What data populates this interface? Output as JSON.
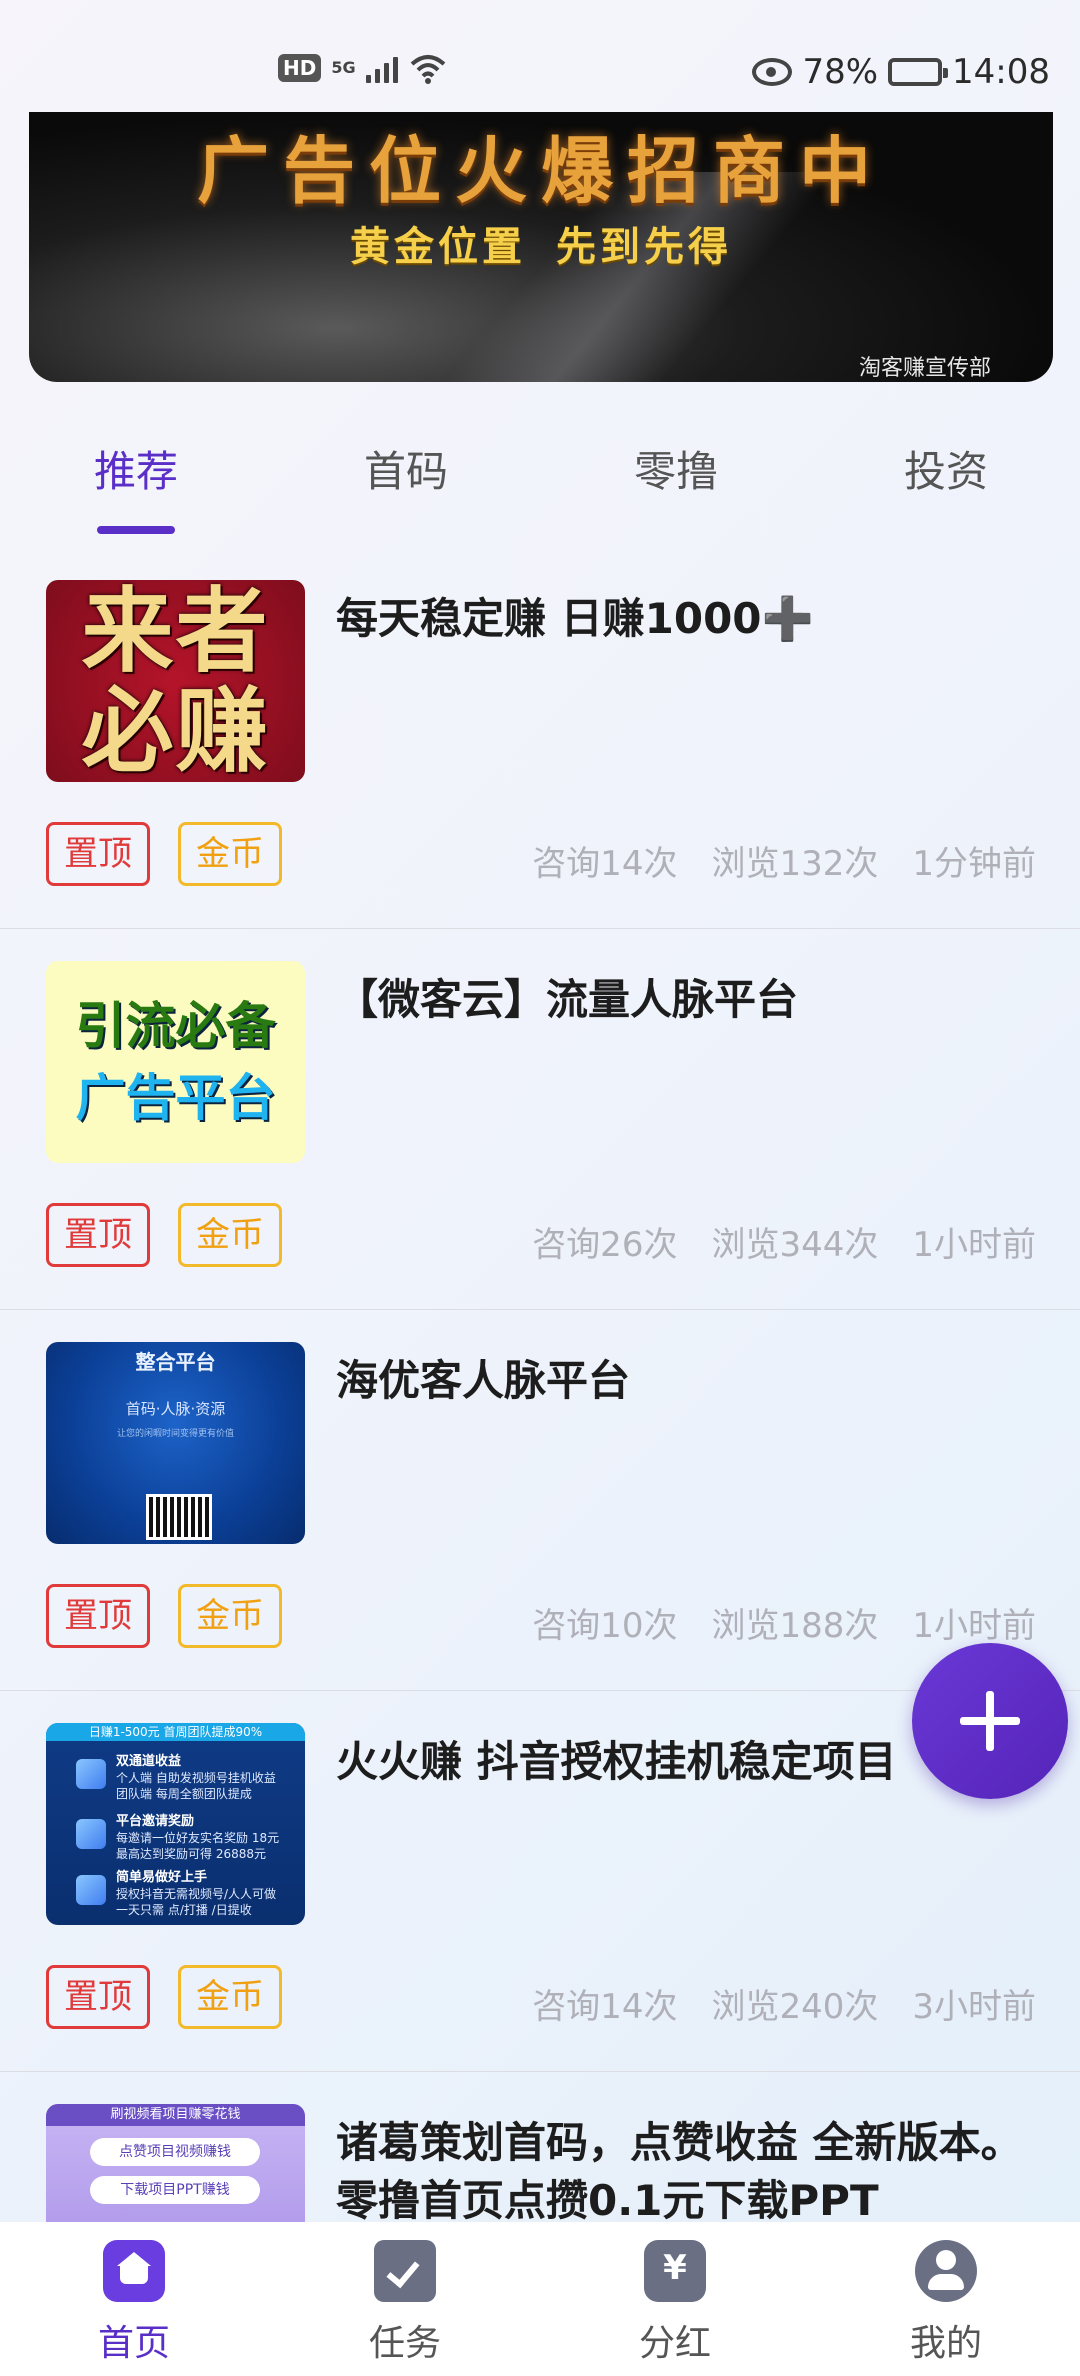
{
  "status_bar": {
    "hd": "HD",
    "network": "5G",
    "battery_percent": "78%",
    "battery_level": 0.78,
    "time": "14:08"
  },
  "banner": {
    "title": "广告位火爆招商中",
    "subtitle_left": "黄金位置",
    "subtitle_right": "先到先得",
    "credit": "淘客赚宣传部"
  },
  "tabs": [
    "推荐",
    "首码",
    "零撸",
    "投资"
  ],
  "active_tab": 0,
  "tags": {
    "top": "置顶",
    "coin": "金币"
  },
  "feed": [
    {
      "title": "每天稳定赚 日赚1000➕",
      "consult": "咨询14次",
      "views": "浏览132次",
      "time": "1分钟前",
      "thumb": {
        "line1": "来者",
        "line2": "必赚"
      }
    },
    {
      "title": "【微客云】流量人脉平台",
      "consult": "咨询26次",
      "views": "浏览344次",
      "time": "1小时前",
      "thumb": {
        "line1": "引流必备",
        "line2": "广告平台"
      }
    },
    {
      "title": "海优客人脉平台",
      "consult": "咨询10次",
      "views": "浏览188次",
      "time": "1小时前",
      "thumb": {
        "line1": "整合平台",
        "line2": "首码·人脉·资源",
        "line3": "让您的闲暇时间变得更有价值"
      }
    },
    {
      "title": "火火赚 抖音授权挂机稳定项目",
      "consult": "咨询14次",
      "views": "浏览240次",
      "time": "3小时前",
      "thumb": {
        "header": "日赚1-500元 首周团队提成90%",
        "r1a": "双通道收益",
        "r1b": "个人端 自助发视频号挂机收益",
        "r1c": "团队端 每周全额团队提成",
        "r2a": "平台邀请奖励",
        "r2b": "每邀请一位好友实名奖励 18元",
        "r2c": "最高达到奖励可得 26888元",
        "r3a": "简单易做好上手",
        "r3b": "授权抖音无需视频号/人人可做",
        "r3c": "一天只需 点/打播 /日提收"
      }
    },
    {
      "title": "诸葛策划首码，点赞收益 全新版本。 零撸首页点攒0.1元下载PPT",
      "consult": "",
      "views": "",
      "time": "",
      "thumb": {
        "header": "刷视频看项目赚零花钱",
        "pill1": "点赞项目视频赚钱",
        "pill2": "下载项目PPT赚钱"
      }
    }
  ],
  "bottom_nav": [
    {
      "label": "首页",
      "icon": "home-icon"
    },
    {
      "label": "任务",
      "icon": "task-icon"
    },
    {
      "label": "分红",
      "icon": "dividend-icon"
    },
    {
      "label": "我的",
      "icon": "profile-icon"
    }
  ],
  "colors": {
    "accent": "#5a2fc8",
    "tag_top": "#e03a3a",
    "tag_coin": "#f0a010",
    "muted": "#b0b0b8"
  }
}
